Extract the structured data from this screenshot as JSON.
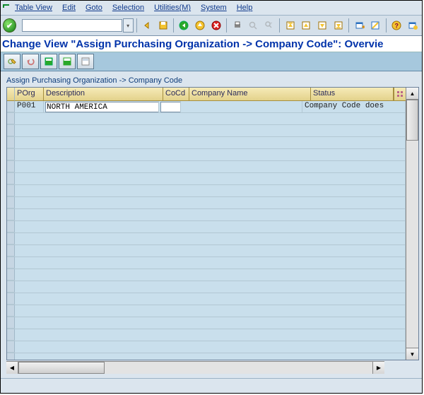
{
  "menu": {
    "items": [
      "Table View",
      "Edit",
      "Goto",
      "Selection",
      "Utilities(M)",
      "System",
      "Help"
    ]
  },
  "toolbar": {
    "cmd_value": "",
    "enter_tt": "Enter",
    "save_tt": "Save",
    "back_tt": "Back",
    "exit_tt": "Exit",
    "cancel_tt": "Cancel",
    "print_tt": "Print",
    "find_tt": "Find",
    "findnext_tt": "Find Next",
    "first_tt": "First Page",
    "prev_tt": "Previous Page",
    "next_tt": "Next Page",
    "last_tt": "Last Page",
    "newsess_tt": "New Session",
    "shortcut_tt": "Create Shortcut",
    "help_tt": "Help",
    "layout_tt": "Local Layout"
  },
  "page_title": "Change View \"Assign Purchasing  Organization -> Company Code\": Overvie",
  "app_toolbar": {
    "change_tt": "Change -> Display",
    "undo_tt": "Undo",
    "selectall_tt": "Select All",
    "selectblock_tt": "Select Block",
    "deselect_tt": "Deselect All"
  },
  "panel_title": "Assign Purchasing  Organization -> Company Code",
  "grid": {
    "headers": {
      "porg": "POrg",
      "desc": "Description",
      "cocd": "CoCd",
      "coname": "Company Name",
      "status": "Status"
    },
    "rows": [
      {
        "porg": "P001",
        "desc": "NORTH AMERICA",
        "cocd": "",
        "coname": "",
        "status": "Company Code      does"
      }
    ]
  }
}
